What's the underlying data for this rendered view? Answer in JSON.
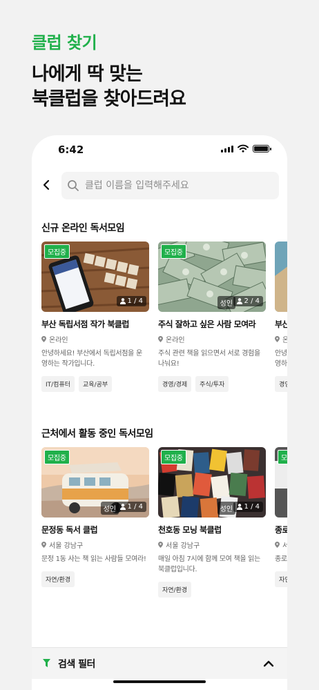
{
  "promo": {
    "eyebrow": "클럽 찾기",
    "headline_line1": "나에게 딱 맞는",
    "headline_line2": "북클럽을 찾아드려요"
  },
  "status_bar": {
    "time": "6:42"
  },
  "search": {
    "placeholder": "클럽 이름을 입력해주세요"
  },
  "sections": [
    {
      "title": "신규 온라인 독서모임",
      "cards": [
        {
          "badge": "모집중",
          "adult": "",
          "count": "1 / 4",
          "title": "부산 독립서점 작가 북클럽",
          "location": "온라인",
          "desc_line1": "안녕하세요! 부산에서 독립서점을 운",
          "desc_line2": "영하는 작가입니다.",
          "tags": [
            "IT/컴퓨터",
            "교육/공부"
          ]
        },
        {
          "badge": "모집중",
          "adult": "성인",
          "count": "2 / 4",
          "title": "주식 잘하고 싶은 사람 모여라",
          "location": "온라인",
          "desc_line1": "주식 관련 책을 읽으면서 서로 경험을",
          "desc_line2": "나눠요!",
          "tags": [
            "경영/경제",
            "주식/투자"
          ]
        },
        {
          "badge": "",
          "adult": "",
          "count": "",
          "title": "부산",
          "location": "온",
          "desc_line1": "안녕",
          "desc_line2": "영하",
          "tags": [
            "경영"
          ]
        }
      ]
    },
    {
      "title": "근처에서 활동 중인 독서모임",
      "cards": [
        {
          "badge": "모집중",
          "adult": "성인",
          "count": "1 / 4",
          "title": "문정동 독서 클럽",
          "location": "서울 강남구",
          "desc_line1": "문정 1동 사는 책 읽는 사람들 모여라!",
          "desc_line2": "",
          "tags": [
            "자연/환경"
          ]
        },
        {
          "badge": "모집중",
          "adult": "성인",
          "count": "1 / 4",
          "title": "천호동 모닝 북클럽",
          "location": "서울 강남구",
          "desc_line1": "매일 아침 7시에 함께 모여 책을 읽는",
          "desc_line2": "북클럽입니다.",
          "tags": [
            "자연/환경"
          ]
        },
        {
          "badge": "모",
          "adult": "",
          "count": "",
          "title": "종로",
          "location": "서",
          "desc_line1": "종로",
          "desc_line2": "",
          "tags": [
            "자연"
          ]
        }
      ]
    }
  ],
  "filter": {
    "label": "검색 필터"
  },
  "colors": {
    "accent": "#20b04b"
  },
  "icons": [
    "back-arrow-icon",
    "search-icon",
    "pin-icon",
    "person-icon",
    "funnel-icon",
    "chevron-up-icon"
  ]
}
